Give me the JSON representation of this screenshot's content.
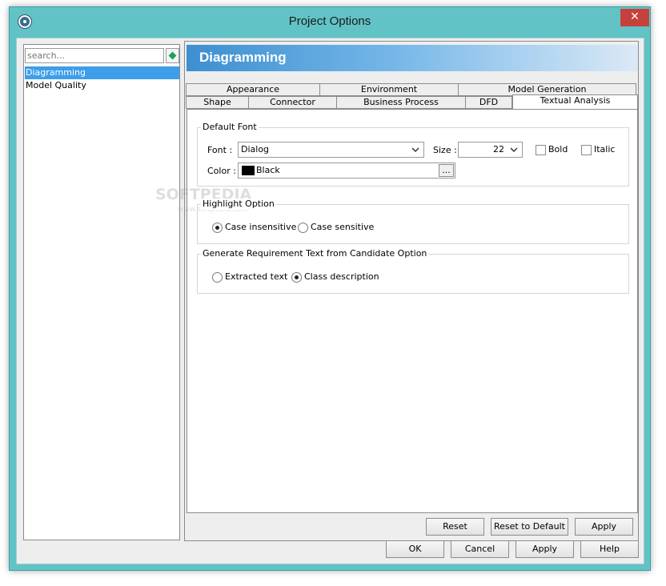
{
  "window": {
    "title": "Project Options",
    "close_glyph": "✕"
  },
  "search": {
    "placeholder": "search..."
  },
  "tree": {
    "items": [
      {
        "label": "Diagramming",
        "selected": true
      },
      {
        "label": "Model Quality",
        "selected": false
      }
    ]
  },
  "banner": {
    "title": "Diagramming"
  },
  "tabs": {
    "row1": [
      "Appearance",
      "Environment",
      "Model Generation"
    ],
    "row2": [
      "Shape",
      "Connector",
      "Business Process",
      "DFD",
      "Textual Analysis"
    ],
    "active": "Textual Analysis"
  },
  "default_font": {
    "title": "Default Font",
    "font_label": "Font :",
    "font_value": "Dialog",
    "size_label": "Size :",
    "size_value": "22",
    "bold_label": "Bold",
    "italic_label": "Italic",
    "color_label": "Color :",
    "color_value": "Black",
    "color_hex": "#000000",
    "more_label": "..."
  },
  "highlight": {
    "title": "Highlight Option",
    "options": [
      "Case insensitive",
      "Case sensitive"
    ],
    "selected": "Case insensitive"
  },
  "requirement": {
    "title": "Generate Requirement Text from Candidate Option",
    "options": [
      "Extracted text",
      "Class description"
    ],
    "selected": "Class description"
  },
  "panel_buttons": {
    "reset": "Reset",
    "reset_default": "Reset to Default",
    "apply": "Apply"
  },
  "dialog_buttons": {
    "ok": "OK",
    "cancel": "Cancel",
    "apply": "Apply",
    "help": "Help"
  },
  "watermark": {
    "main": "SOFTPEDIA",
    "sub": "www.softpedia.com"
  }
}
